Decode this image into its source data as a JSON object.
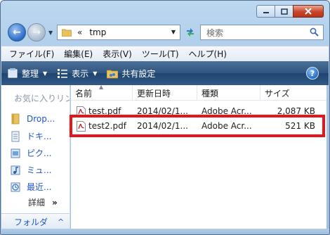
{
  "address_bar": {
    "breadcrumb_separator": "«",
    "path": "tmp"
  },
  "search": {
    "placeholder": "検索"
  },
  "menu": {
    "items": [
      "ファイル(F)",
      "編集(E)",
      "表示(V)",
      "ツール(T)",
      "ヘルプ(H)"
    ]
  },
  "toolbar": {
    "organize_label": "整理",
    "view_label": "表示",
    "share_label": "共有設定"
  },
  "navigation": {
    "favorites_header": "お気に入りリン",
    "items": [
      {
        "label": "Drop...",
        "icon": "folder-icon"
      },
      {
        "label": "ドキ...",
        "icon": "documents-icon"
      },
      {
        "label": "ピク...",
        "icon": "pictures-icon"
      },
      {
        "label": "ミュ...",
        "icon": "music-icon"
      },
      {
        "label": "最近...",
        "icon": "recent-icon"
      }
    ],
    "details_label": "詳細",
    "details_chevron": "»",
    "folders_label": "フォルダ",
    "folders_chevron": "^"
  },
  "file_list": {
    "columns": [
      "名前",
      "更新日時",
      "種類",
      "サイズ"
    ],
    "rows": [
      {
        "name": "test.pdf",
        "date": "2014/02/1...",
        "type": "Adobe Acr...",
        "size": "2,087 KB"
      },
      {
        "name": "test2.pdf",
        "date": "2014/02/1...",
        "type": "Adobe Acr...",
        "size": "521 KB"
      }
    ]
  },
  "colors": {
    "highlight": "#e8141c",
    "toolbar": "#2f5580",
    "link": "#1f56c2"
  }
}
